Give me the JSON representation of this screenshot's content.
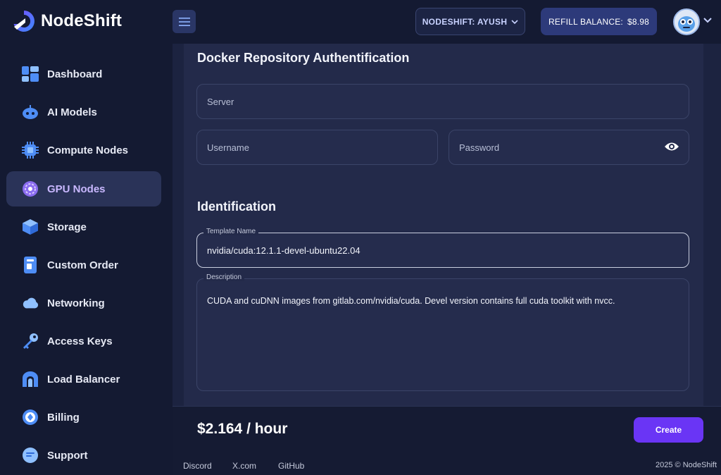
{
  "app": {
    "name": "NodeShift",
    "org_label": "NODESHIFT: AYUSH",
    "refill_label": "REFILL BALANCE:",
    "balance": "$8.98"
  },
  "sidebar": {
    "items": [
      {
        "label": "Dashboard",
        "icon": "dashboard-icon"
      },
      {
        "label": "AI Models",
        "icon": "robot-icon"
      },
      {
        "label": "Compute Nodes",
        "icon": "chip-icon"
      },
      {
        "label": "GPU Nodes",
        "icon": "gpu-icon",
        "active": true
      },
      {
        "label": "Storage",
        "icon": "cube-icon"
      },
      {
        "label": "Custom Order",
        "icon": "order-icon"
      },
      {
        "label": "Networking",
        "icon": "cloud-icon"
      },
      {
        "label": "Access Keys",
        "icon": "key-icon"
      },
      {
        "label": "Load Balancer",
        "icon": "balancer-icon"
      },
      {
        "label": "Billing",
        "icon": "billing-icon"
      },
      {
        "label": "Support",
        "icon": "support-icon"
      }
    ]
  },
  "docker": {
    "title": "Docker Repository Authentification",
    "server_placeholder": "Server",
    "username_placeholder": "Username",
    "password_placeholder": "Password"
  },
  "identification": {
    "title": "Identification",
    "template_label": "Template Name",
    "template_value": "nvidia/cuda:12.1.1-devel-ubuntu22.04",
    "description_label": "Description",
    "description_value": "CUDA and cuDNN images from gitlab.com/nvidia/cuda.  Devel version contains full cuda toolkit with nvcc."
  },
  "footer": {
    "price": "$2.164 / hour",
    "create_label": "Create",
    "links": [
      "Discord",
      "X.com",
      "GitHub"
    ],
    "copyright": "2025 © NodeShift"
  },
  "colors": {
    "accent": "#6a35f5",
    "active_nav": "#2a3358",
    "background": "#151b33"
  }
}
